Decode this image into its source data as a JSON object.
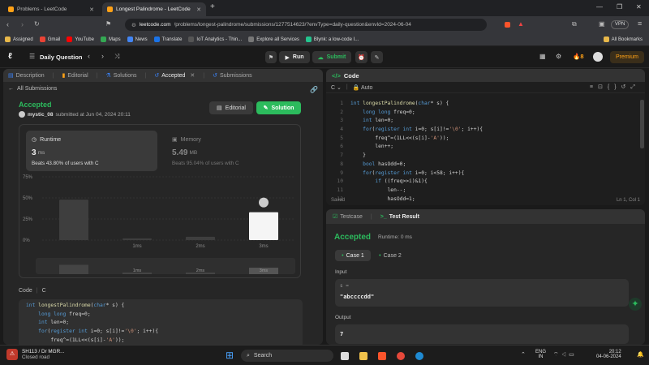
{
  "browser": {
    "tabs": [
      {
        "title": "Problems - LeetCode",
        "active": false
      },
      {
        "title": "Longest Palindrome - LeetCode",
        "active": true
      }
    ],
    "new_tab": "+",
    "url_host": "leetcode.com",
    "url_path": "/problems/longest-palindrome/submissions/1277514623/?envType=daily-question&envId=2024-06-04",
    "vpn_label": "VPN",
    "bookmarks": [
      "Assigned",
      "Gmail",
      "YouTube",
      "Maps",
      "News",
      "Translate",
      "IoT Analytics - Thin...",
      "Explore all Services",
      "Blynk: a low-code I..."
    ],
    "all_bookmarks": "All Bookmarks"
  },
  "header": {
    "title": "Daily Question",
    "run": "Run",
    "submit": "Submit",
    "streak": "8",
    "premium": "Premium"
  },
  "left_tabs": {
    "description": "Description",
    "editorial": "Editorial",
    "solutions": "Solutions",
    "accepted": "Accepted",
    "submissions": "Submissions"
  },
  "submission": {
    "back": "All Submissions",
    "status": "Accepted",
    "user": "mystic_08",
    "submitted": "submitted at Jun 04, 2024 20:11",
    "editorial_btn": "Editorial",
    "solution_btn": "Solution",
    "runtime_label": "Runtime",
    "runtime_value": "3",
    "runtime_unit": "ms",
    "runtime_beats": "Beats 43.80% of users with C",
    "memory_label": "Memory",
    "memory_value": "5.49",
    "memory_unit": "MB",
    "memory_beats": "Beats 95.04% of users with C",
    "code_label": "Code",
    "code_lang": "C"
  },
  "chart_data": {
    "type": "bar",
    "y_ticks": [
      "75%",
      "50%",
      "25%",
      "0%"
    ],
    "ylim": [
      0,
      75
    ],
    "categories": [
      "",
      "1ms",
      "2ms",
      "3ms"
    ],
    "values": [
      48,
      2,
      4,
      33
    ],
    "highlight_index": 3,
    "mini_labels": [
      "1ms",
      "2ms",
      "3ms"
    ]
  },
  "code_lines": [
    "int longestPalindrome(char* s) {",
    "    long long freq=0;",
    "    int len=0;",
    "    for(register int i=0; s[i]!='\\0'; i++){",
    "        freq^=(1LL<<(s[i]-'A'));",
    "        len++;",
    "    }",
    "    bool hasOdd=0;",
    "    for(register int i=0; i<58; i++){",
    "        if ((freq>>i)&1){",
    "            len--;",
    "            hasOdd=1;"
  ],
  "left_code_lines": [
    "int longestPalindrome(char* s) {",
    "    long long freq=0;",
    "    int len=0;",
    "    for(register int i=0; s[i]!='\\0'; i++){",
    "        freq^=(1LL<<(s[i]-'A'));"
  ],
  "editor": {
    "title": "Code",
    "lang": "C",
    "auto": "Auto",
    "saved": "Saved",
    "cursor": "Ln 1, Col 1"
  },
  "test": {
    "testcase_tab": "Testcase",
    "result_tab": "Test Result",
    "status": "Accepted",
    "runtime": "Runtime: 0 ms",
    "case1": "Case 1",
    "case2": "Case 2",
    "input_label": "Input",
    "input_var": "s =",
    "input_value": "\"abccccdd\"",
    "output_label": "Output",
    "output_value": "7"
  },
  "taskbar": {
    "news_title": "SH113 / Dr MGR...",
    "news_sub": "Closed road",
    "search": "Search",
    "lang1": "ENG",
    "lang2": "IN",
    "time": "20:12",
    "date": "04-06-2024"
  },
  "colors": {
    "accent_green": "#2cbb5d",
    "bar_gray": "#3e3e3e",
    "orange": "#ffa116"
  }
}
